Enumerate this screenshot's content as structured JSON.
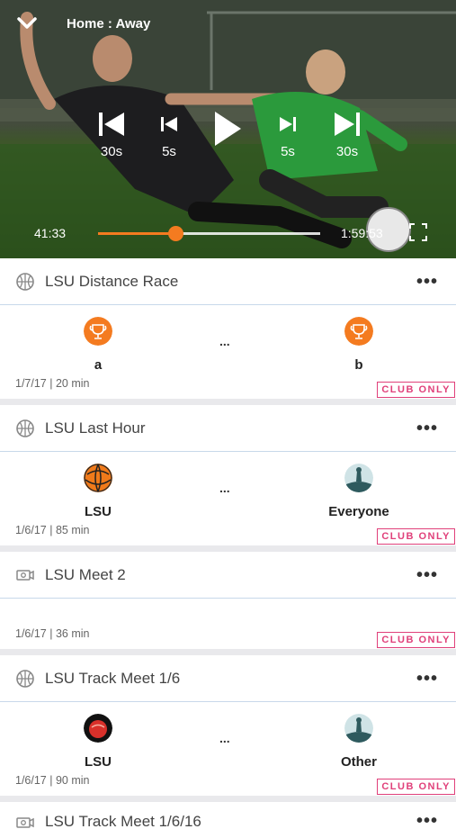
{
  "player": {
    "title": "Home : Away",
    "elapsed": "41:33",
    "total": "1:59:53",
    "progress": 0.35,
    "controls": {
      "back30": "30s",
      "back5": "5s",
      "fwd5": "5s",
      "fwd30": "30s"
    },
    "accent": "#f47b20"
  },
  "videos": [
    {
      "title": "LSU Distance Race",
      "home": "a",
      "away": "b",
      "separator": "...",
      "meta": "1/7/17 | 20 min",
      "badge": "CLUB ONLY",
      "more": "•••"
    },
    {
      "title": "LSU Last Hour",
      "home": "LSU",
      "away": "Everyone",
      "separator": "...",
      "meta": "1/6/17 | 85 min",
      "badge": "CLUB ONLY",
      "more": "•••"
    },
    {
      "title": "LSU Meet 2",
      "meta": "1/6/17 | 36 min",
      "badge": "CLUB ONLY",
      "more": "•••"
    },
    {
      "title": "LSU Track Meet 1/6",
      "home": "LSU",
      "away": "Other",
      "separator": "...",
      "meta": "1/6/17 | 90 min",
      "badge": "CLUB ONLY",
      "more": "•••"
    },
    {
      "title": "LSU Track Meet 1/6/16",
      "more": "•••"
    }
  ],
  "colors": {
    "badge": "#e0407a",
    "trophy": "#f47b20",
    "divider": "#c8d8ea"
  }
}
